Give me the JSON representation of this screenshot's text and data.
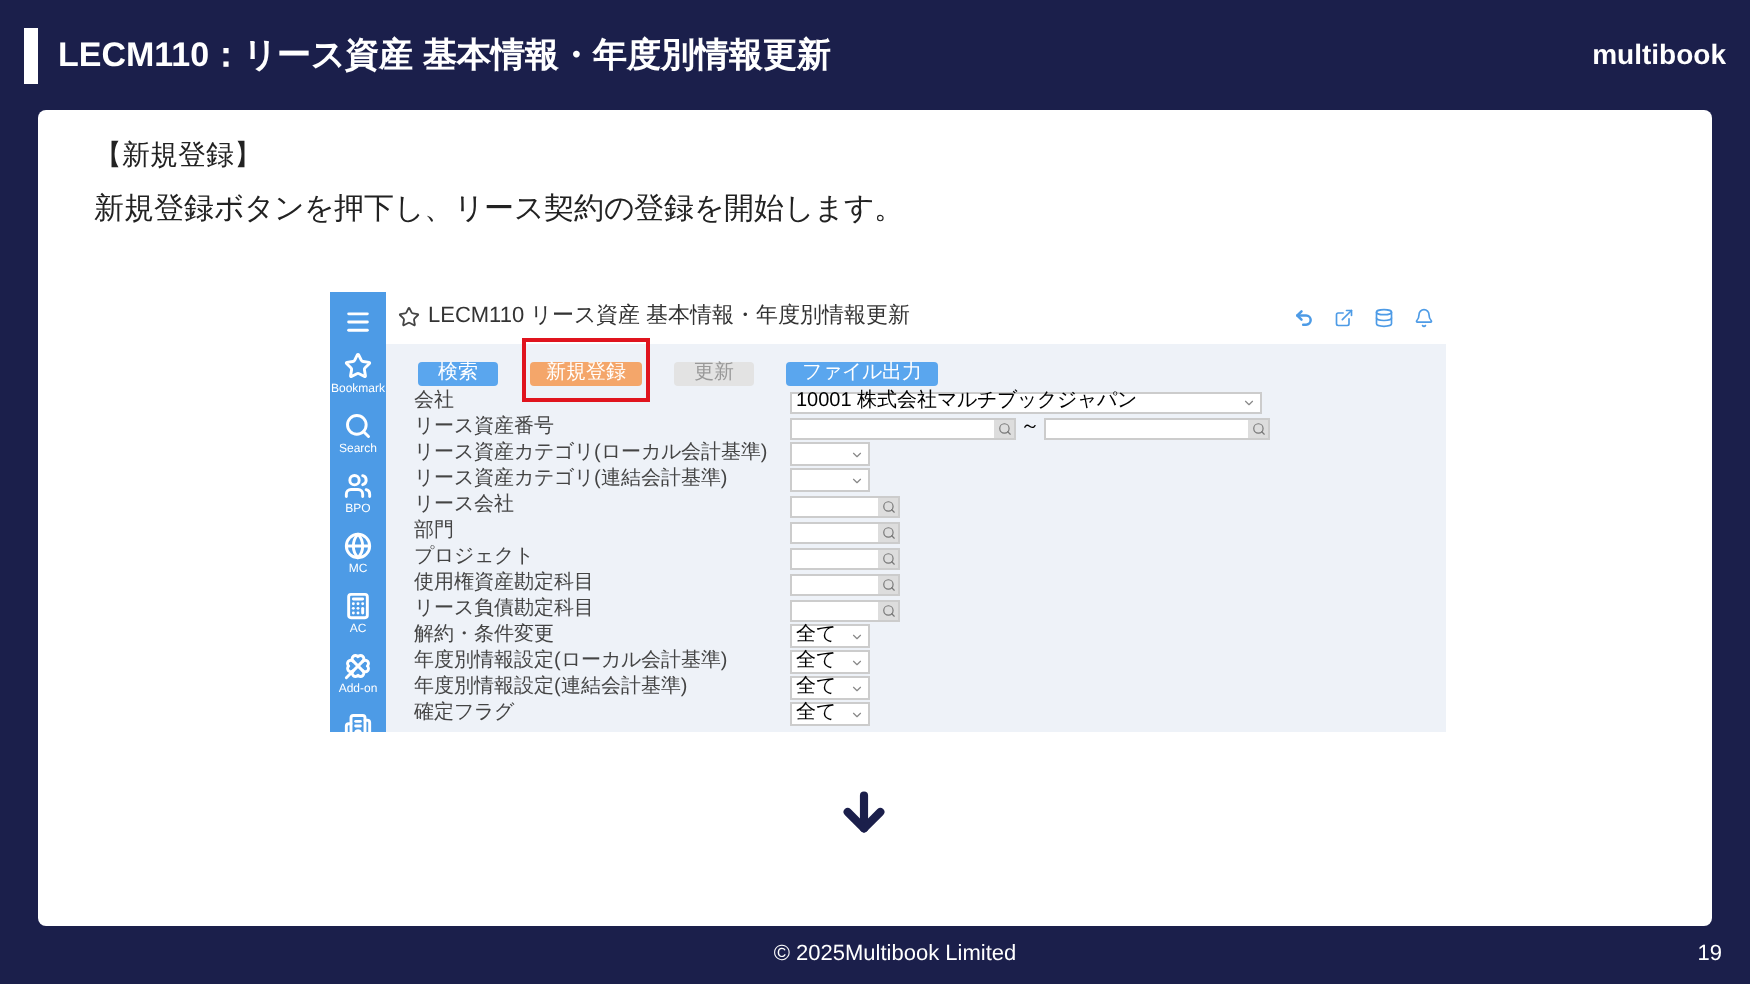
{
  "header": {
    "title": "LECM110：リース資産 基本情報・年度別情報更新",
    "logo": "multibook"
  },
  "content": {
    "heading": "【新規登録】",
    "description": "新規登録ボタンを押下し、リース契約の登録を開始します。"
  },
  "screenshot": {
    "title": "LECM110 リース資産 基本情報・年度別情報更新",
    "sidebar": [
      {
        "kind": "menu"
      },
      {
        "kind": "star",
        "label": "Bookmark"
      },
      {
        "kind": "search",
        "label": "Search"
      },
      {
        "kind": "people",
        "label": "BPO"
      },
      {
        "kind": "globe",
        "label": "MC"
      },
      {
        "kind": "calculator",
        "label": "AC"
      },
      {
        "kind": "clover",
        "label": "Add-on"
      },
      {
        "kind": "building"
      }
    ],
    "buttons": [
      {
        "label": "検索",
        "kind": "primary",
        "highlighted": false
      },
      {
        "label": "新規登録",
        "kind": "accent",
        "highlighted": true
      },
      {
        "label": "更新",
        "kind": "disabled",
        "highlighted": false
      },
      {
        "label": "ファイル出力",
        "kind": "primary",
        "highlighted": false
      }
    ],
    "rows": [
      {
        "label": "会社",
        "kind": "select",
        "value": "10001 株式会社マルチブックジャパン"
      },
      {
        "label": "リース資産番号",
        "kind": "range",
        "separator": "～"
      },
      {
        "label": "リース資産カテゴリ(ローカル会計基準)",
        "kind": "dropdown"
      },
      {
        "label": "リース資産カテゴリ(連結会計基準)",
        "kind": "dropdown"
      },
      {
        "label": "リース会社",
        "kind": "lookup"
      },
      {
        "label": "部門",
        "kind": "lookup"
      },
      {
        "label": "プロジェクト",
        "kind": "lookup"
      },
      {
        "label": "使用権資産勘定科目",
        "kind": "lookup"
      },
      {
        "label": "リース負債勘定科目",
        "kind": "lookup"
      },
      {
        "label": "解約・条件変更",
        "kind": "dropdown",
        "value": "全て"
      },
      {
        "label": "年度別情報設定(ローカル会計基準)",
        "kind": "dropdown",
        "value": "全て"
      },
      {
        "label": "年度別情報設定(連結会計基準)",
        "kind": "dropdown",
        "value": "全て"
      },
      {
        "label": "確定フラグ",
        "kind": "dropdown",
        "value": "全て"
      }
    ]
  },
  "footer": {
    "copyright": "© 2025Multibook Limited",
    "page": "19"
  }
}
